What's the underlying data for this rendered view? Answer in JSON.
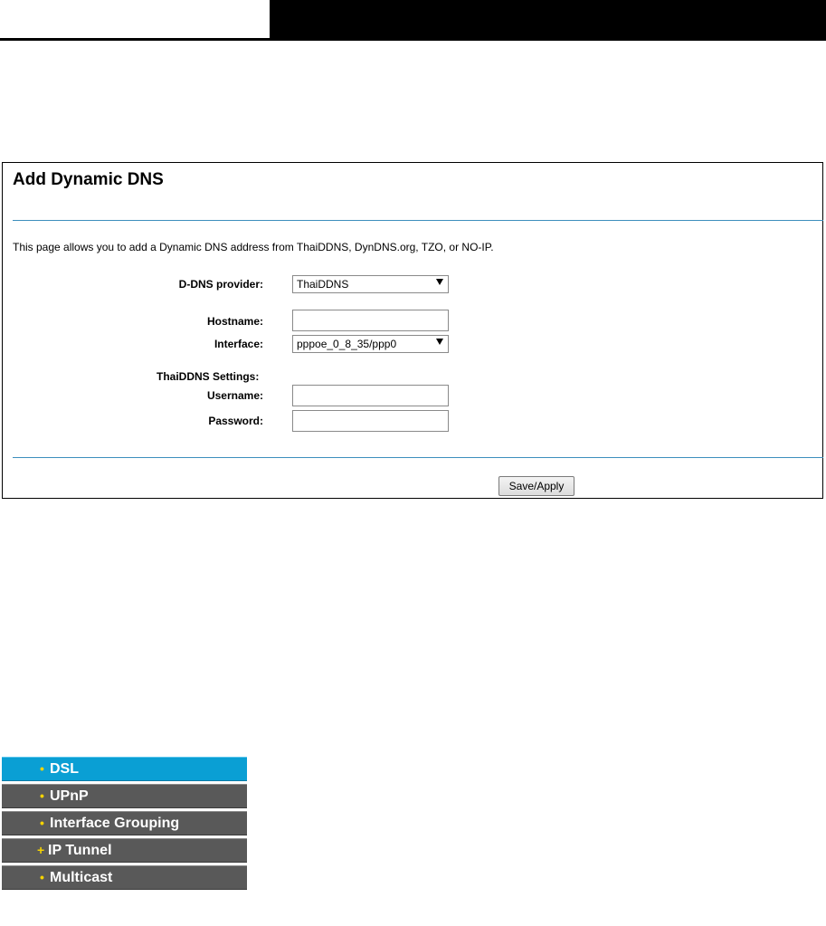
{
  "panel": {
    "title": "Add Dynamic DNS",
    "description": "This page allows you to add a Dynamic DNS address from ThaiDDNS, DynDNS.org, TZO, or NO-IP.",
    "fields": {
      "provider_label": "D-DNS provider:",
      "provider_value": "ThaiDDNS",
      "hostname_label": "Hostname:",
      "hostname_value": "",
      "interface_label": "Interface:",
      "interface_value": "pppoe_0_8_35/ppp0",
      "settings_heading": "ThaiDDNS Settings:",
      "username_label": "Username:",
      "username_value": "",
      "password_label": "Password:",
      "password_value": ""
    },
    "save_label": "Save/Apply"
  },
  "nav": {
    "items": [
      {
        "bullet": "•",
        "label": "DSL",
        "active": true
      },
      {
        "bullet": "•",
        "label": "UPnP",
        "active": false
      },
      {
        "bullet": "•",
        "label": "Interface Grouping",
        "active": false
      },
      {
        "bullet": "+",
        "label": "IP Tunnel",
        "active": false
      },
      {
        "bullet": "•",
        "label": "Multicast",
        "active": false
      }
    ]
  },
  "colors": {
    "accent": "#0a9fd4",
    "nav_background": "#595959",
    "nav_bullet": "#f5d300",
    "panel_rule": "#3d8fbd"
  }
}
